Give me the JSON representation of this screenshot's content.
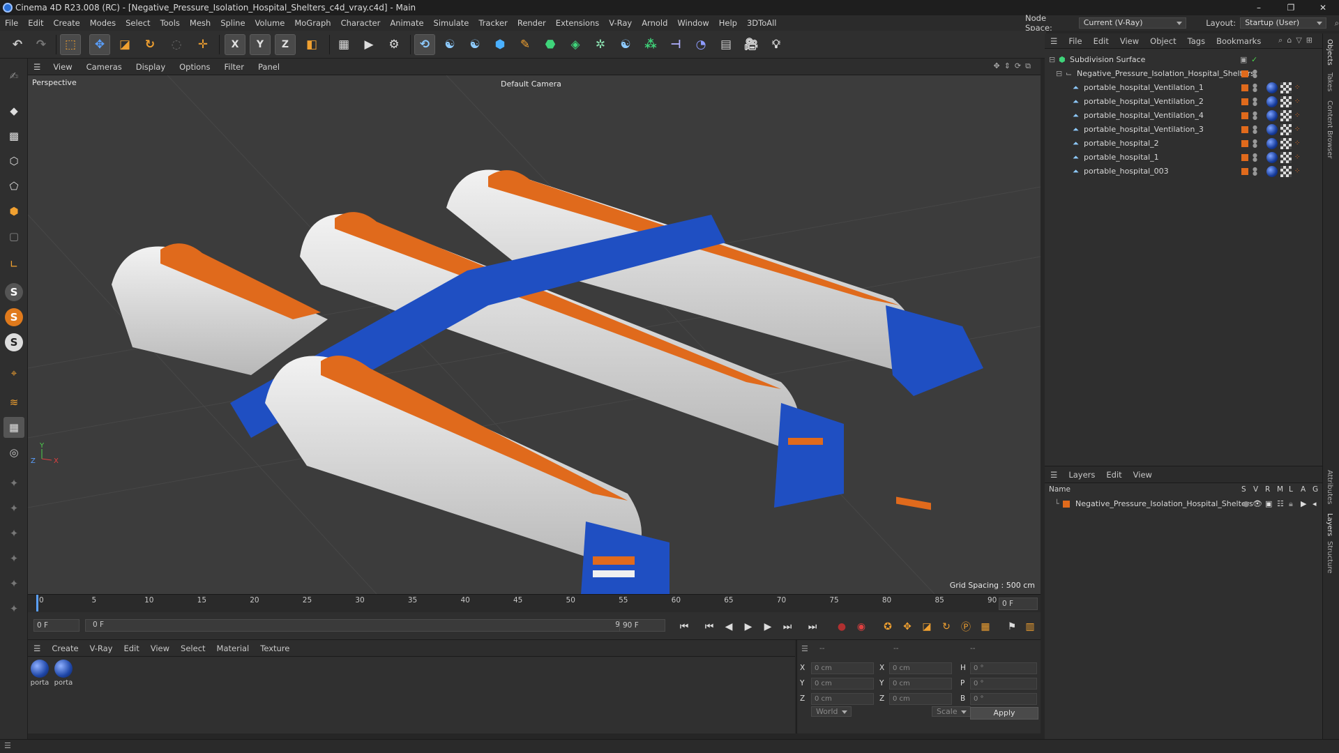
{
  "window": {
    "title": "Cinema 4D R23.008 (RC) - [Negative_Pressure_Isolation_Hospital_Shelters_c4d_vray.c4d] - Main",
    "controls": [
      "–",
      "❐",
      "✕"
    ]
  },
  "menubar": {
    "items": [
      "File",
      "Edit",
      "Create",
      "Modes",
      "Select",
      "Tools",
      "Mesh",
      "Spline",
      "Volume",
      "MoGraph",
      "Character",
      "Animate",
      "Simulate",
      "Tracker",
      "Render",
      "Extensions",
      "V-Ray",
      "Arnold",
      "Window",
      "Help",
      "3DToAll"
    ],
    "node_space_label": "Node Space:",
    "node_space_value": "Current (V-Ray)",
    "layout_label": "Layout:",
    "layout_value": "Startup (User)"
  },
  "toolbar": {
    "axis_x": "X",
    "axis_y": "Y",
    "axis_z": "Z"
  },
  "left_tools": {
    "s1": "S",
    "s2": "S",
    "s3": "S"
  },
  "viewport": {
    "menu": [
      "View",
      "Cameras",
      "Display",
      "Options",
      "Filter",
      "Panel"
    ],
    "label": "Perspective",
    "camera": "Default Camera",
    "grid_spacing": "Grid Spacing : 500 cm"
  },
  "timeline": {
    "ticks": [
      "0",
      "5",
      "10",
      "15",
      "20",
      "25",
      "30",
      "35",
      "40",
      "45",
      "50",
      "55",
      "60",
      "65",
      "70",
      "75",
      "80",
      "85",
      "90"
    ],
    "frame_display": "0 F",
    "start_field": "0 F",
    "range_start": "0 F",
    "range_end": "90 F",
    "end_field": "90 F"
  },
  "materials": {
    "menu": [
      "Create",
      "V-Ray",
      "Edit",
      "View",
      "Select",
      "Material",
      "Texture"
    ],
    "items": [
      "porta",
      "porta"
    ]
  },
  "coordinates": {
    "pos_labels": [
      "X",
      "Y",
      "Z"
    ],
    "size_labels": [
      "X",
      "Y",
      "Z"
    ],
    "rot_labels": [
      "H",
      "P",
      "B"
    ],
    "pos_values": [
      "0 cm",
      "0 cm",
      "0 cm"
    ],
    "size_values": [
      "0 cm",
      "0 cm",
      "0 cm"
    ],
    "rot_values": [
      "0 °",
      "0 °",
      "0 °"
    ],
    "col_a": "--",
    "col_b": "--",
    "col_c": "--",
    "world": "World",
    "scale": "Scale",
    "apply": "Apply"
  },
  "objects": {
    "menu": [
      "File",
      "Edit",
      "View",
      "Object",
      "Tags",
      "Bookmarks"
    ],
    "root": "Subdivision Surface",
    "group": "Negative_Pressure_Isolation_Hospital_Shelters",
    "children": [
      "portable_hospital_Ventilation_1",
      "portable_hospital_Ventilation_2",
      "portable_hospital_Ventilation_4",
      "portable_hospital_Ventilation_3",
      "portable_hospital_2",
      "portable_hospital_1",
      "portable_hospital_003"
    ]
  },
  "layers": {
    "menu": [
      "Layers",
      "Edit",
      "View"
    ],
    "header_name": "Name",
    "flags": [
      "S",
      "V",
      "R",
      "M",
      "L",
      "A",
      "G"
    ],
    "row": "Negative_Pressure_Isolation_Hospital_Shelters"
  },
  "right_tabs": [
    "Objects",
    "Takes",
    "Content Browser",
    "Attributes",
    "Layers",
    "Structure"
  ],
  "colors": {
    "accent_orange": "#e06a1c",
    "shelter_blue": "#1f4fc2",
    "viewport_bg": "#3c3c3c"
  }
}
